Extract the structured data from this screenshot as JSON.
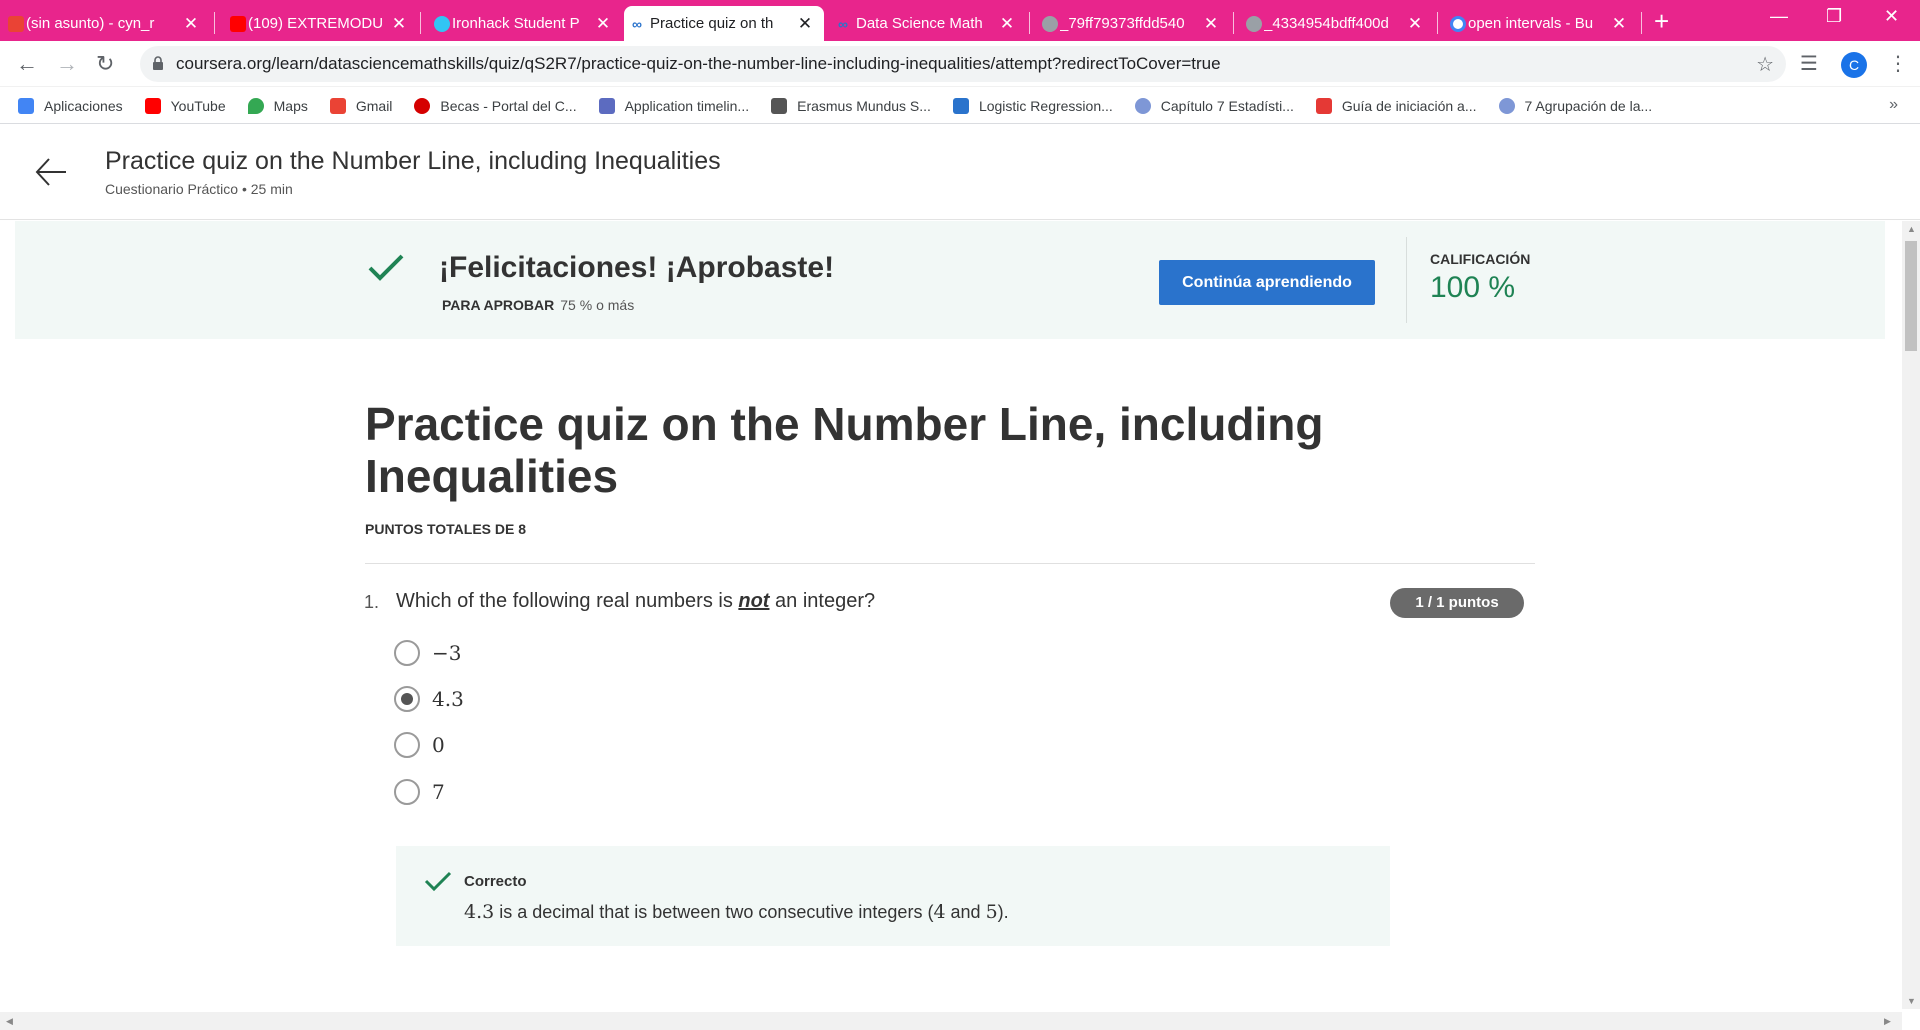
{
  "tabs": [
    {
      "label": "(sin asunto) - cyn_r",
      "close": "✕",
      "color": "#ea4335"
    },
    {
      "label": "(109) EXTREMODU",
      "close": "✕",
      "color": "#ff0000"
    },
    {
      "label": "Ironhack Student P",
      "close": "✕",
      "color": "#32c5f4"
    },
    {
      "label": "Practice quiz on th",
      "close": "✕",
      "color": "#2a73cc"
    },
    {
      "label": "Data Science Math",
      "close": "✕",
      "color": "#2a73cc"
    },
    {
      "label": "_79ff79373ffdd540",
      "close": "✕",
      "color": "#9aa0a6"
    },
    {
      "label": "_4334954bdff400d",
      "close": "✕",
      "color": "#9aa0a6"
    },
    {
      "label": "open intervals - Bu",
      "close": "✕",
      "color": "#4285f4"
    }
  ],
  "toolbar": {
    "url": "coursera.org/learn/datasciencemathskills/quiz/qS2R7/practice-quiz-on-the-number-line-including-inequalities/attempt?redirectToCover=true",
    "profile_letter": "C"
  },
  "bookmarks": [
    {
      "label": "Aplicaciones",
      "color": "#4285f4"
    },
    {
      "label": "YouTube",
      "color": "#ff0000"
    },
    {
      "label": "Maps",
      "color": "#34a853"
    },
    {
      "label": "Gmail",
      "color": "#ea4335"
    },
    {
      "label": "Becas - Portal del C...",
      "color": "#d50000"
    },
    {
      "label": "Application timelin...",
      "color": "#5c6bc0"
    },
    {
      "label": "Erasmus Mundus S...",
      "color": "#555555"
    },
    {
      "label": "Logistic Regression...",
      "color": "#2a73cc"
    },
    {
      "label": "Capítulo 7 Estadísti...",
      "color": "#7e97d6"
    },
    {
      "label": "Guía de iniciación a...",
      "color": "#e53935"
    },
    {
      "label": "7 Agrupación de la...",
      "color": "#7e97d6"
    }
  ],
  "header": {
    "title": "Practice quiz on the Number Line, including Inequalities",
    "subtitle": "Cuestionario Práctico • 25 min"
  },
  "banner": {
    "congrats": "¡Felicitaciones! ¡Aprobaste!",
    "pass_label": "PARA APROBAR",
    "pass_value": "75 % o más",
    "continue_button": "Continúa aprendiendo",
    "grade_label": "CALIFICACIÓN",
    "grade_value": "100 %"
  },
  "quiz": {
    "title": "Practice quiz on the Number Line, including Inequalities",
    "total_points": "PUNTOS TOTALES DE 8",
    "question": {
      "number": "1.",
      "text_before": "Which of the following real numbers is ",
      "text_emph": "not",
      "text_after": " an integer?",
      "points": "1 / 1 puntos",
      "options": [
        "−3",
        "4.3",
        "0",
        "7"
      ],
      "selected_index": 1,
      "feedback_title": "Correcto",
      "feedback_value": "4.3",
      "feedback_text_1": " is a decimal that is between two consecutive integers (",
      "feedback_n1": "4",
      "feedback_and": " and ",
      "feedback_n2": "5",
      "feedback_end": ")."
    }
  },
  "colors": {
    "tabstrip": "#e8258c",
    "primary_button": "#2a73cc",
    "success": "#1f8354",
    "banner_bg": "#f2f8f6"
  }
}
